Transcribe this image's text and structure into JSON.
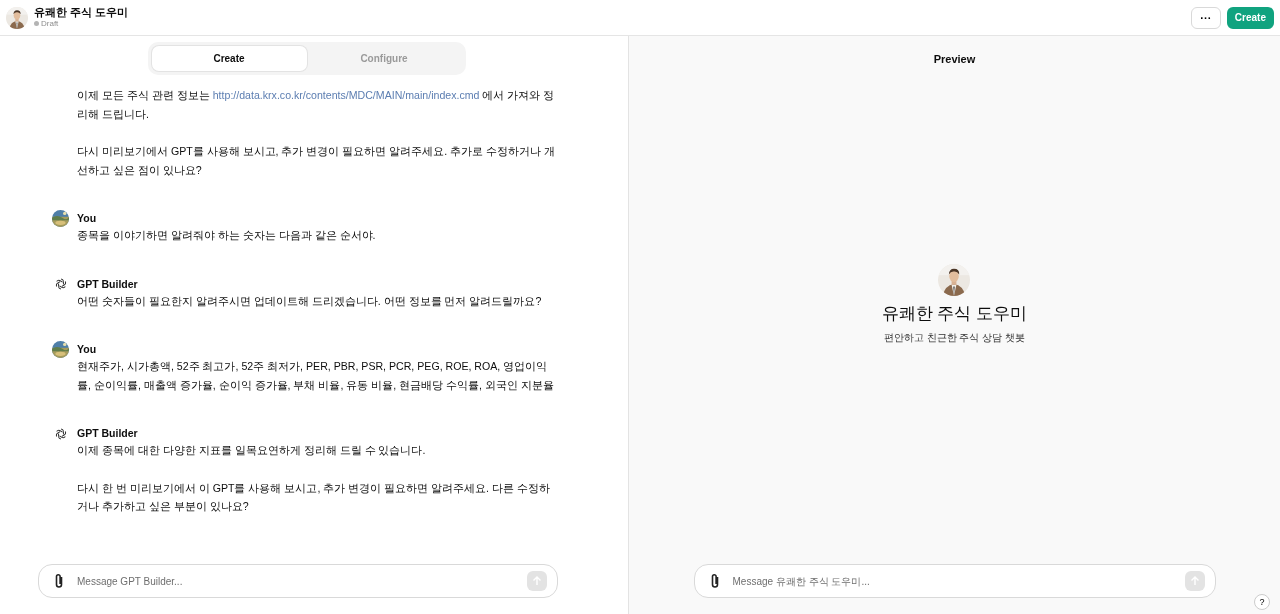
{
  "header": {
    "title": "유쾌한 주식 도우미",
    "status": "Draft",
    "more_button": "···",
    "create_button": "Create"
  },
  "tabs": [
    {
      "label": "Create",
      "selected": true
    },
    {
      "label": "Configure",
      "selected": false
    }
  ],
  "messages": [
    {
      "paragraphs": [
        [
          {
            "kind": "text",
            "text": "이제 모든 주식 관련 정보는 "
          },
          {
            "kind": "link",
            "text": "http://data.krx.co.kr/contents/MDC/MAIN/main/index.cmd"
          },
          {
            "kind": "text",
            "text": " 에서 가져와 정리해 드립니다."
          }
        ],
        [
          {
            "kind": "text",
            "text": "다시 미리보기에서 GPT를 사용해 보시고, 추가 변경이 필요하면 알려주세요. 추가로 수정하거나 개선하고 싶은 점이 있나요?"
          }
        ]
      ]
    },
    {
      "kind": "user",
      "author": "You",
      "paragraphs": [
        [
          {
            "kind": "text",
            "text": "종목을 이야기하면 알려줘야 하는 숫자는 다음과 같은 순서야."
          }
        ]
      ]
    },
    {
      "kind": "gpt",
      "author": "GPT Builder",
      "paragraphs": [
        [
          {
            "kind": "text",
            "text": "어떤 숫자들이 필요한지 알려주시면 업데이트해 드리겠습니다. 어떤 정보를 먼저 알려드릴까요?"
          }
        ]
      ]
    },
    {
      "kind": "user",
      "author": "You",
      "paragraphs": [
        [
          {
            "kind": "text",
            "text": "현재주가, 시가총액, 52주 최고가, 52주 최저가, PER, PBR, PSR, PCR, PEG, ROE, ROA, 영업이익률, 순이익률, 매출액 증가율, 순이익 증가율, 부채 비율, 유동 비율, 현금배당 수익률, 외국인 지분율"
          }
        ]
      ]
    },
    {
      "kind": "gpt",
      "author": "GPT Builder",
      "paragraphs": [
        [
          {
            "kind": "text",
            "text": "이제 종목에 대한 다양한 지표를 일목요연하게 정리해 드릴 수 있습니다."
          }
        ],
        [
          {
            "kind": "text",
            "text": "다시 한 번 미리보기에서 이 GPT를 사용해 보시고, 추가 변경이 필요하면 알려주세요. 다른 수정하거나 추가하고 싶은 부분이 있나요?"
          }
        ]
      ]
    }
  ],
  "builder_input": {
    "placeholder": "Message GPT Builder..."
  },
  "preview": {
    "title": "Preview",
    "name": "유쾌한 주식 도우미",
    "description": "편안하고 친근한 주식 상담 챗봇",
    "input": {
      "placeholder": "Message 유쾌한 주식 도우미..."
    },
    "help": "?"
  }
}
